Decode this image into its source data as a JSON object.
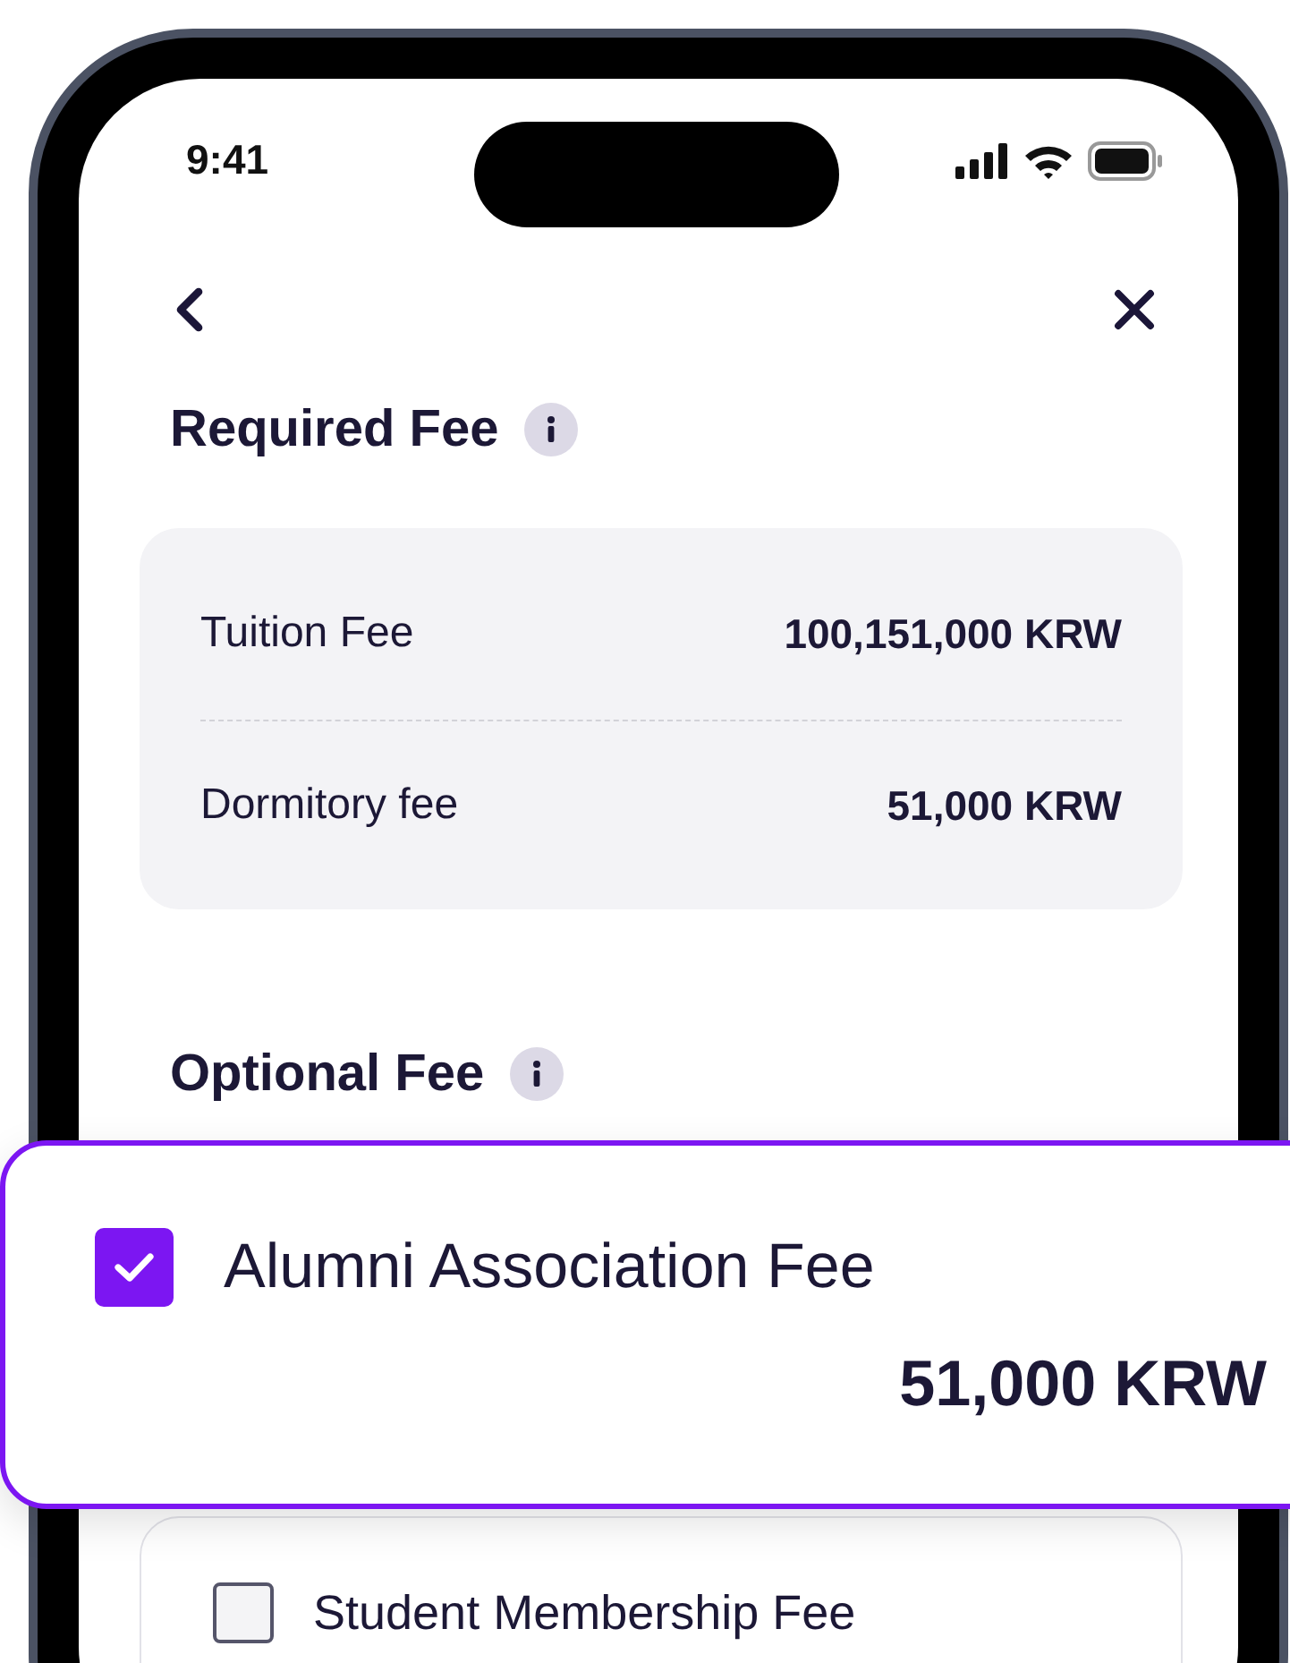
{
  "status_bar": {
    "time": "9:41"
  },
  "required_fee": {
    "title": "Required Fee",
    "items": [
      {
        "label": "Tuition Fee",
        "amount": "100,151,000 KRW"
      },
      {
        "label": "Dormitory fee",
        "amount": "51,000 KRW"
      }
    ]
  },
  "optional_fee": {
    "title": "Optional Fee",
    "items": [
      {
        "label": "Alumni Association Fee",
        "amount": "51,000 KRW",
        "checked": true
      },
      {
        "label": "Student Membership Fee",
        "checked": false
      }
    ]
  }
}
